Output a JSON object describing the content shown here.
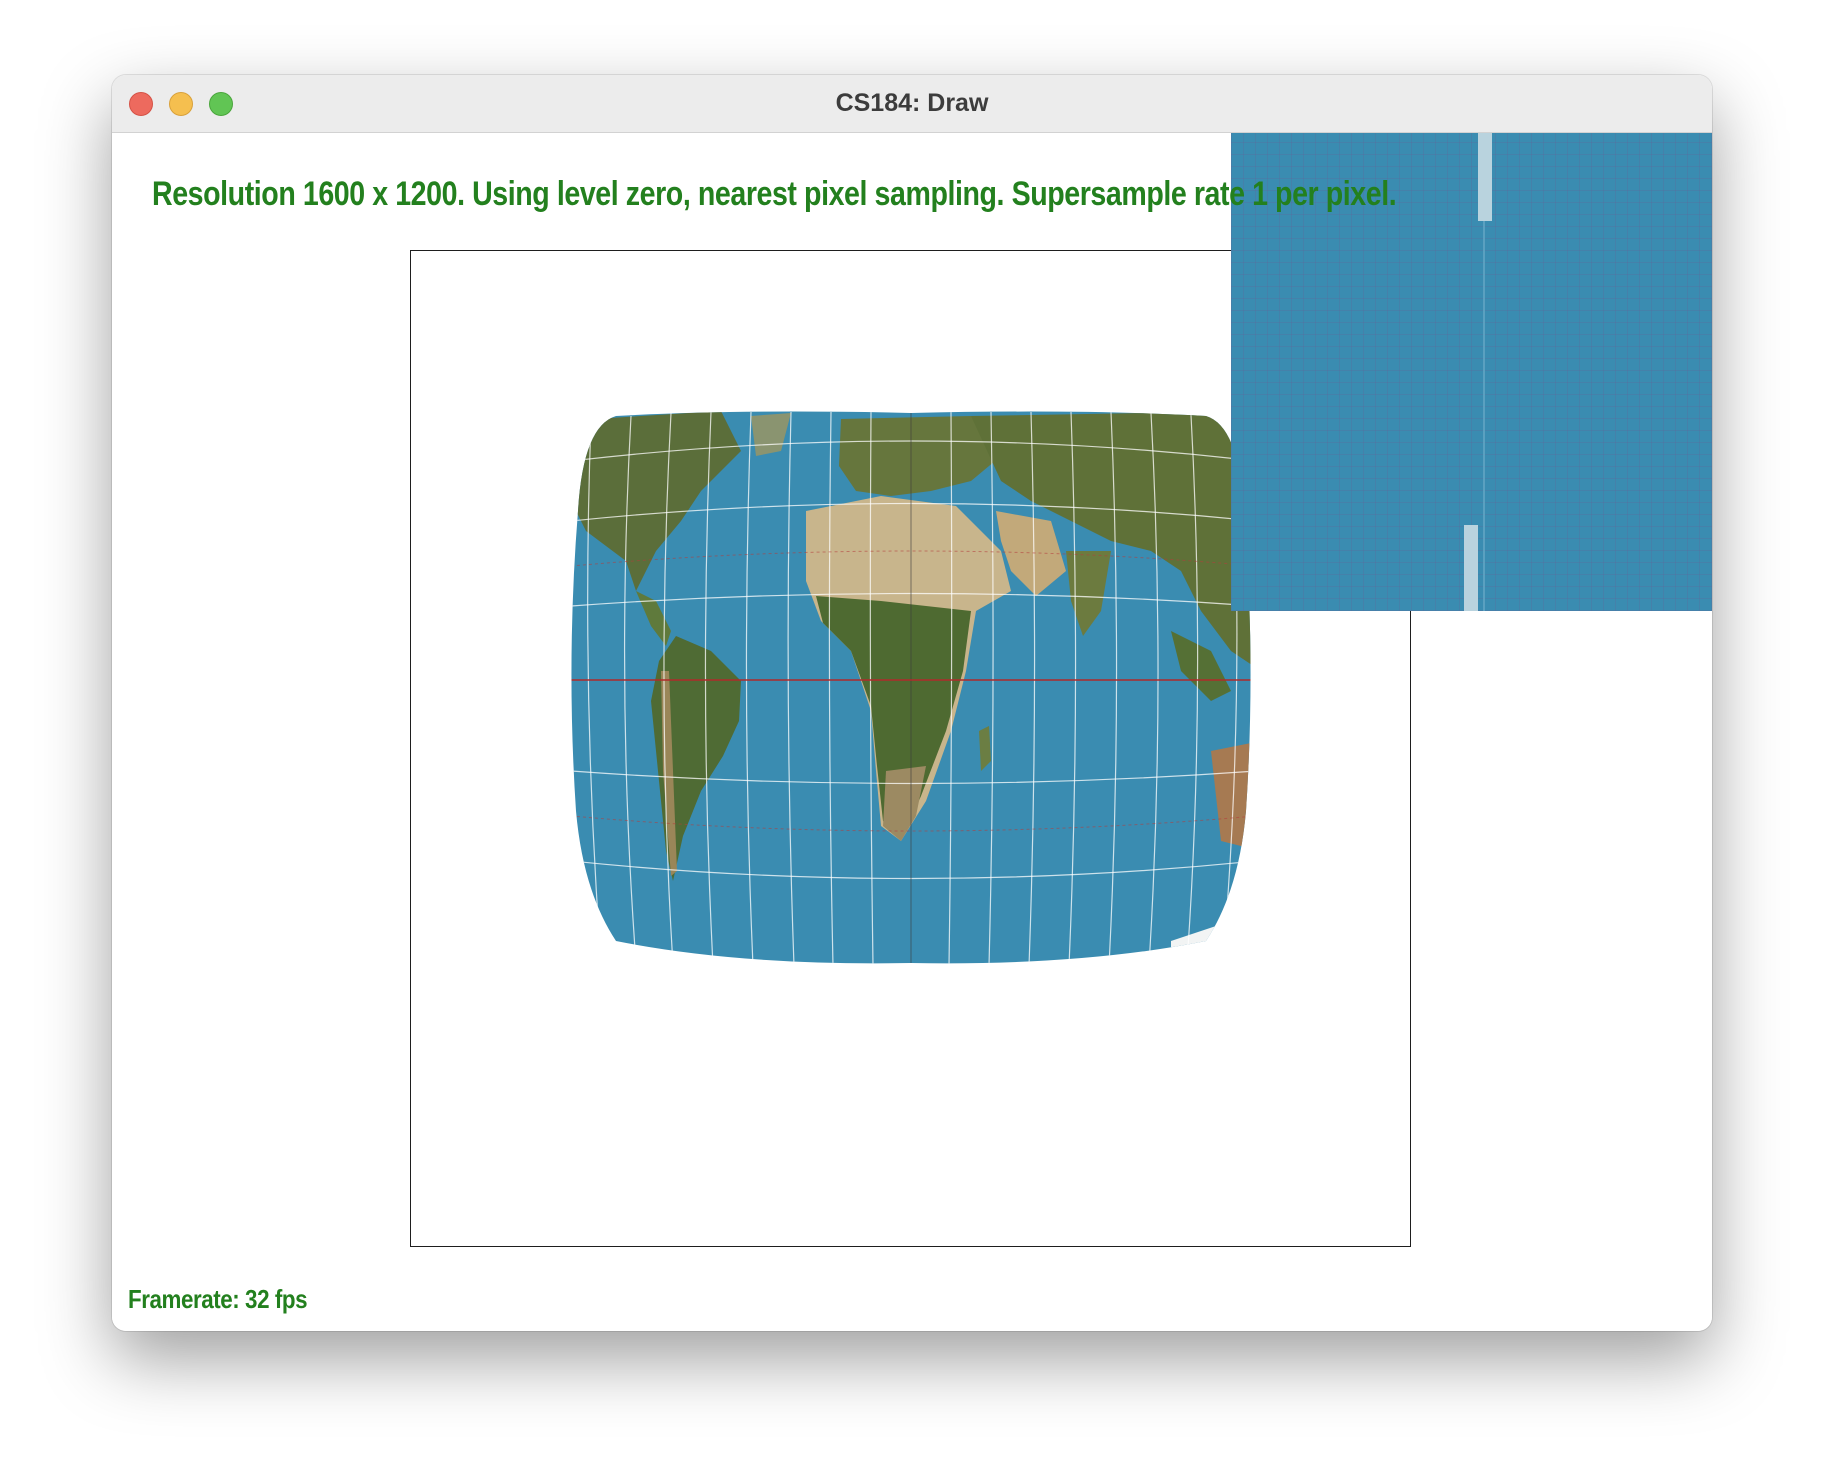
{
  "window": {
    "title": "CS184: Draw"
  },
  "hud": {
    "resolution_text": "Resolution 1600 x 1200. Using level zero, nearest pixel sampling. Supersample rate 1 per pixel.",
    "framerate_text": "Framerate: 32 fps"
  },
  "colors": {
    "hud_text": "#23801e",
    "ocean": "#3a8cb1",
    "equator": "#b02a2a"
  }
}
